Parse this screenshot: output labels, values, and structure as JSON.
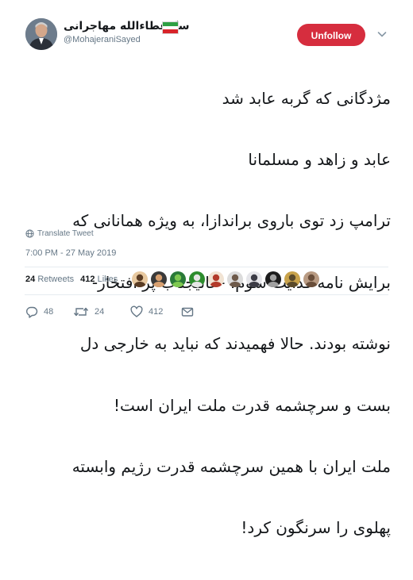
{
  "user": {
    "display_name": "سیّدعطاءالله مهاجرانی",
    "handle": "@MohajeraniSayed"
  },
  "follow_button": {
    "label": "Unfollow"
  },
  "tweet": {
    "lines": [
      "مژدگانی که  گربه عابد شد",
      "عابد و زاهد و مسلمانا",
      "ترامپ زد توی باروی براندازا، به ویژه همانانی که",
      "برایش نامه فدایت شوم، -عالیجناب پر افتخار-",
      "نوشته بودند. حالا فهمیدند که نباید به خارجی دل",
      "بست و سرچشمه قدرت ملت ایران است!",
      "ملت ایران با همین سرچشمه قدرت رژیم وابسته",
      "پهلوی را سرنگون کرد!"
    ]
  },
  "translate": {
    "label": "Translate Tweet"
  },
  "timestamp": "7:00 PM - 27 May 2019",
  "stats": {
    "retweets_count": "24",
    "retweets_label": "Retweets",
    "likes_count": "412",
    "likes_label": "Likes"
  },
  "likers": [
    {
      "name": "liker-1",
      "bg": "#e8c9a0",
      "fg": "#5a3c24"
    },
    {
      "name": "liker-2",
      "bg": "#3a3a3a",
      "fg": "#d8a070"
    },
    {
      "name": "liker-3",
      "bg": "#2a7a38",
      "fg": "#7ec850"
    },
    {
      "name": "liker-4",
      "bg": "#2d8c2d",
      "fg": "#e6e6e6"
    },
    {
      "name": "liker-5",
      "bg": "#f1e3d3",
      "fg": "#b23a2a"
    },
    {
      "name": "liker-6",
      "bg": "#dcdcdc",
      "fg": "#6e5a4a"
    },
    {
      "name": "liker-7",
      "bg": "#e6e6ea",
      "fg": "#3c3c46"
    },
    {
      "name": "liker-8",
      "bg": "#1c1c1c",
      "fg": "#a0a0a0"
    },
    {
      "name": "liker-9",
      "bg": "#c8a24a",
      "fg": "#5a4a2a"
    },
    {
      "name": "liker-10",
      "bg": "#b89a82",
      "fg": "#6a4e3a"
    }
  ],
  "actions": {
    "reply_count": "48",
    "retweet_count": "24",
    "like_count": "412"
  },
  "colors": {
    "unfollow_bg": "#d62d3e",
    "secondary_text": "#657786",
    "primary_text": "#14171a"
  },
  "icons": [
    "caret-down-icon",
    "globe-icon",
    "reply-icon",
    "retweet-icon",
    "like-icon",
    "message-icon"
  ]
}
